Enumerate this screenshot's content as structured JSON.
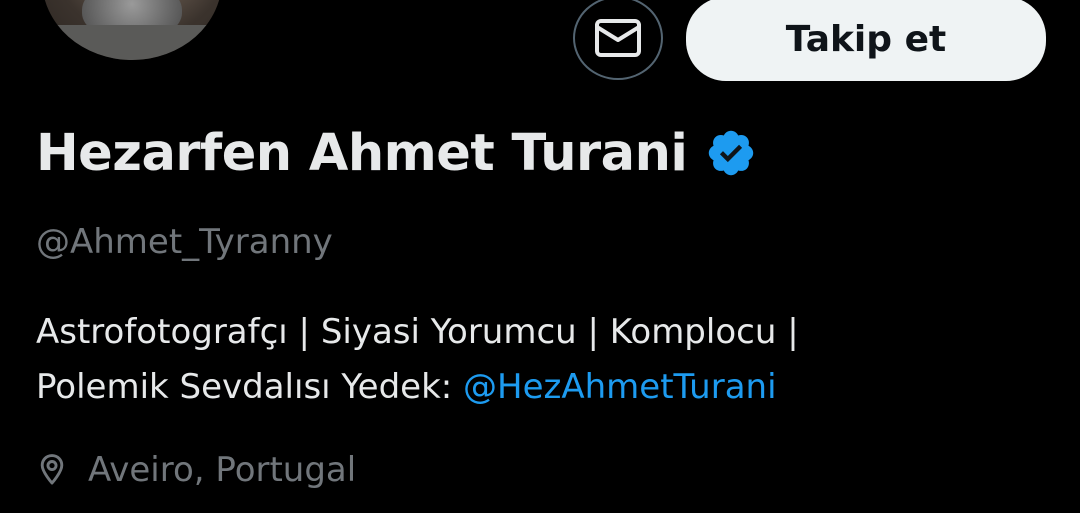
{
  "profile": {
    "display_name": "Hezarfen Ahmet Turani",
    "handle": "@Ahmet_Tyranny",
    "verified_icon": "verified-badge-icon",
    "bio": {
      "line1": "Astrofotografçı | Siyasi Yorumcu | Komplocu |",
      "line2_text": "Polemik Sevdalısı Yedek: ",
      "line2_mention": "@HezAhmetTurani"
    },
    "location": "Aveiro, Portugal"
  },
  "actions": {
    "message_icon": "envelope-icon",
    "follow_label": "Takip et"
  },
  "colors": {
    "background": "#000000",
    "primary_text": "#e7e9ea",
    "secondary_text": "#71767b",
    "link": "#1d9bf0",
    "verified": "#1d9bf0",
    "follow_button_bg": "#eff3f4",
    "follow_button_text": "#0f1419",
    "button_border": "#536471"
  }
}
